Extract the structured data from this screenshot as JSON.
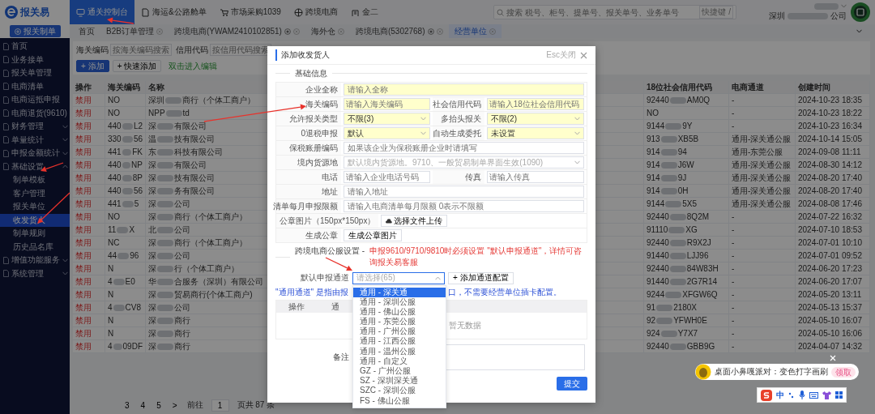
{
  "topbar": {
    "app_name": "报关易",
    "nav": [
      {
        "label": "通关控制台",
        "selected": true
      },
      {
        "label": "海运&公路舱单",
        "selected": false
      },
      {
        "label": "市场采购1039",
        "selected": false
      },
      {
        "label": "跨境电商",
        "selected": false
      },
      {
        "label": "金二",
        "selected": false
      }
    ],
    "search": {
      "placeholder": "搜索 税号、柜号、提单号、报关单号、业务单号",
      "shortcut": "快捷键 /"
    },
    "company": [
      "深圳",
      "公司"
    ]
  },
  "create_button": "报关制单",
  "page_tabs": [
    {
      "label": "首页",
      "selected": false,
      "closable": false,
      "pinned": false
    },
    {
      "label": "B2B订单管理",
      "selected": false,
      "closable": true,
      "pinned": false
    },
    {
      "label": "跨境电商(YWAM2410102851)",
      "selected": false,
      "closable": true,
      "pinned": true
    },
    {
      "label": "海外仓",
      "selected": false,
      "closable": true,
      "pinned": false
    },
    {
      "label": "跨境电商(5302768)",
      "selected": false,
      "closable": true,
      "pinned": true
    },
    {
      "label": "经营单位",
      "selected": true,
      "closable": true,
      "pinned": false
    }
  ],
  "sidebar": [
    {
      "label": "首页",
      "selected": false
    },
    {
      "label": "业务接单",
      "selected": false
    },
    {
      "label": "报关单管理",
      "selected": false
    },
    {
      "label": "电商清单",
      "selected": false
    },
    {
      "label": "电商运抵申报",
      "selected": false
    },
    {
      "label": "电商退货(9610)",
      "selected": false
    },
    {
      "label": "财务管理",
      "selected": false,
      "expanded": false
    },
    {
      "label": "单量统计",
      "selected": false,
      "expanded": false
    },
    {
      "label": "申报金额统计",
      "selected": false,
      "expanded": false
    },
    {
      "label": "基础设置",
      "selected": false,
      "expanded": true,
      "children": [
        {
          "label": "制单模板",
          "selected": false
        },
        {
          "label": "客户管理",
          "selected": false
        },
        {
          "label": "报关单位",
          "selected": false
        },
        {
          "label": "收发货人",
          "selected": true
        },
        {
          "label": "制单规则",
          "selected": false
        },
        {
          "label": "历史品名库",
          "selected": false
        }
      ]
    },
    {
      "label": "增值功能服务",
      "selected": false,
      "expanded": false
    },
    {
      "label": "系统管理",
      "selected": false,
      "expanded": false
    }
  ],
  "filters": [
    {
      "label": "海关编码",
      "placeholder": "按海关编码搜索"
    },
    {
      "label": "信用代码",
      "placeholder": "按信用代码搜索"
    }
  ],
  "actions": [
    {
      "label": "+ 添加",
      "kind": "primary"
    },
    {
      "label": "+ 快速添加",
      "kind": "plain"
    },
    {
      "label": "双击进入编辑",
      "kind": "hint"
    }
  ],
  "table": {
    "columns": [
      "操作",
      "海关编码",
      "名称",
      "18位社会信用代码",
      "电商通道",
      "创建时间"
    ],
    "rows": [
      {
        "action": "禁用",
        "code": "NO",
        "name": [
          "深圳",
          "商行（个体工商户）"
        ],
        "credit": [
          "92440",
          "AM0Q"
        ],
        "channel": "-",
        "created": "2024-10-23 18:35"
      },
      {
        "action": "禁用",
        "code": "NO",
        "name": [
          "NPP",
          "td"
        ],
        "credit": "NO",
        "channel": "-",
        "created": "2024-10-23 18:22"
      },
      {
        "action": "禁用",
        "code": [
          "440",
          "L2"
        ],
        "name": [
          "深",
          "有限公司"
        ],
        "credit": [
          "9144",
          "9Y"
        ],
        "channel": "-",
        "created": "2024-10-23 16:34"
      },
      {
        "action": "禁用",
        "code": [
          "330",
          "56"
        ],
        "name": [
          "温",
          "技有限公司"
        ],
        "credit": [
          "913",
          "XB5B"
        ],
        "channel": "通用-深关通公服",
        "created": "2024-10-14 15:05"
      },
      {
        "action": "禁用",
        "code": [
          "441",
          "FK"
        ],
        "name": [
          "东",
          "科技有限公司"
        ],
        "credit": [
          "914",
          "94"
        ],
        "channel": "通用-东莞公服",
        "created": "2024-09-08 11:11"
      },
      {
        "action": "禁用",
        "code": [
          "440",
          "NP"
        ],
        "name": [
          "深",
          "有限公司"
        ],
        "credit": [
          "914",
          "J6W"
        ],
        "channel": "通用-深关通公服",
        "created": "2024-08-30 14:12"
      },
      {
        "action": "禁用",
        "code": [
          "440",
          "8P"
        ],
        "name": [
          "深",
          "技有限公司"
        ],
        "credit": [
          "914",
          "9J"
        ],
        "channel": "通用-深关通公服",
        "created": "2024-08-20 17:40"
      },
      {
        "action": "禁用",
        "code": [
          "440",
          "56"
        ],
        "name": [
          "深",
          "务有限公司"
        ],
        "credit": [
          "914",
          "0H"
        ],
        "channel": "通用-深关通公服",
        "created": "2024-08-20 17:40"
      },
      {
        "action": "禁用",
        "code": [
          "441",
          "5"
        ],
        "name": [
          "深",
          "公司"
        ],
        "credit": [
          "9144",
          "5X5"
        ],
        "channel": "通用-深关通公服",
        "created": "2024-08-08 17:46"
      },
      {
        "action": "禁用",
        "code": "NO",
        "name": [
          "深",
          "商行（个体工商户）"
        ],
        "credit": [
          "92440",
          "8Q2M"
        ],
        "channel": "-",
        "created": "2024-07-22 16:32"
      },
      {
        "action": "禁用",
        "code": [
          "11",
          "X"
        ],
        "name": [
          "北",
          "公司"
        ],
        "credit": [
          "91110",
          "XG"
        ],
        "channel": "-",
        "created": "2024-07-10 18:53"
      },
      {
        "action": "禁用",
        "code": "NC",
        "name": [
          "深",
          "商行（个体工商户）"
        ],
        "credit": [
          "92440",
          "R9X2J"
        ],
        "channel": "-",
        "created": "2024-07-01 10:10"
      },
      {
        "action": "禁用",
        "code": [
          "44",
          "96"
        ],
        "name": [
          "深",
          "公司"
        ],
        "credit": [
          "91440",
          "LJJ96"
        ],
        "channel": "-",
        "created": "2024-07-01 09:52"
      },
      {
        "action": "禁用",
        "code": "N",
        "name": [
          "深",
          "行（个体工商户）"
        ],
        "credit": [
          "92440",
          "84W83H"
        ],
        "channel": "-",
        "created": "2024-06-20 17:23"
      },
      {
        "action": "禁用",
        "code": [
          "4",
          "E0"
        ],
        "name": [
          "华",
          "合服务（深圳）有限公司"
        ],
        "credit": [
          "91440",
          "2G7R14"
        ],
        "channel": "-",
        "created": "2024-06-20 17:07"
      },
      {
        "action": "禁用",
        "code": "N",
        "name": [
          "深",
          "贸易商行(个体工商户)"
        ],
        "credit": [
          "9244",
          "XFGW6Q"
        ],
        "channel": "-",
        "created": "2024-05-20 13:11"
      },
      {
        "action": "禁用",
        "code": [
          "4",
          "CV8"
        ],
        "name": [
          "深",
          "公司"
        ],
        "credit": [
          "91",
          "2180X"
        ],
        "channel": "-",
        "created": "2024-05-13 15:37"
      },
      {
        "action": "禁用",
        "code": "N",
        "name": [
          "深",
          "商行"
        ],
        "credit": [
          "92",
          "YFWH0E"
        ],
        "channel": "-",
        "created": "2024-05-10 16:07"
      },
      {
        "action": "禁用",
        "code": "N",
        "name": [
          "深",
          "商行"
        ],
        "credit": [
          "924",
          "Y7X7"
        ],
        "channel": "-",
        "created": "2024-05-10 16:06"
      },
      {
        "action": "禁用",
        "code": [
          "4",
          "09DF"
        ],
        "name": [
          "深",
          "商行"
        ],
        "credit": [
          "92440",
          "GBB9G"
        ],
        "channel": "-",
        "created": "2024-04-07 14:32"
      }
    ]
  },
  "pager": {
    "pages": [
      "3",
      "4",
      "5"
    ],
    "next": ">",
    "goto_label": "前往",
    "goto_value": "1",
    "total": "页共 87 条"
  },
  "modal": {
    "title": "添加收发货人",
    "esc_hint": "Esc关闭",
    "basic_section": "基础信息",
    "rows": [
      [
        {
          "label": "企业全称",
          "kind": "input",
          "placeholder": "请输入全称",
          "required": true
        }
      ],
      [
        {
          "label": "海关编码",
          "kind": "input",
          "placeholder": "请输入海关编码",
          "required": true
        },
        {
          "label": "社会信用代码",
          "kind": "input",
          "placeholder": "请输入18位社会信用代码",
          "required": true
        }
      ],
      [
        {
          "label": "允许报关类型",
          "kind": "select",
          "value": "不限(3)",
          "required": true
        },
        {
          "label": "多抬头报关",
          "kind": "select",
          "value": "不限(2)",
          "required": true
        }
      ],
      [
        {
          "label": "0退税申报",
          "kind": "select",
          "value": "默认",
          "required": true
        },
        {
          "label": "自动生成委托",
          "kind": "select",
          "value": "未设置",
          "required": true
        }
      ],
      [
        {
          "label": "保税账册编码",
          "kind": "input",
          "placeholder": "如果该企业为保税账册企业时请填写",
          "required": false
        }
      ],
      [
        {
          "label": "境内货源地",
          "kind": "select",
          "placeholder": "默认境内货源地。9710、一般贸易制单界面生效(1090)",
          "required": false
        }
      ],
      [
        {
          "label": "电话",
          "kind": "input",
          "placeholder": "请输入企业电话号码",
          "required": false
        },
        {
          "label": "传真",
          "kind": "input",
          "placeholder": "请输入传真",
          "required": false
        }
      ],
      [
        {
          "label": "地址",
          "kind": "input",
          "placeholder": "请输入地址",
          "required": false
        }
      ],
      [
        {
          "label": "清单每月申报限额",
          "kind": "input",
          "placeholder": "请输入电商清单每月限额 0表示不限额",
          "required": false
        }
      ],
      [
        {
          "label": "公章图片（150px*150px）",
          "kind": "upload",
          "button": "选择文件上传"
        }
      ],
      [
        {
          "label": "生成公章",
          "kind": "button",
          "button": "生成公章图片"
        }
      ]
    ],
    "ecom_section": {
      "title": "跨境电商公服设置 -",
      "warning": "申报9610/9710/9810时必须设置 \"默认申报通道\"，详情可咨询报关易客服"
    },
    "channel": {
      "label": "默认申报通道",
      "placeholder": "请选择(65)",
      "expanded": true,
      "add_button": "+ 添加通道配置",
      "options": [
        {
          "label": "通用 - 深关通",
          "selected": true
        },
        {
          "label": "通用 - 深圳公服",
          "selected": false
        },
        {
          "label": "通用 - 佛山公服",
          "selected": false
        },
        {
          "label": "通用 - 东莞公服",
          "selected": false
        },
        {
          "label": "通用 - 广州公服",
          "selected": false
        },
        {
          "label": "通用 - 江西公服",
          "selected": false
        },
        {
          "label": "通用 - 温州公服",
          "selected": false
        },
        {
          "label": "通用 - 自定义",
          "selected": false
        },
        {
          "label": "GZ - 广州公服",
          "selected": false
        },
        {
          "label": "SZ - 深圳深关通",
          "selected": false
        },
        {
          "label": "SZC - 深圳公服",
          "selected": false
        },
        {
          "label": "FS - 佛山公服",
          "selected": false
        }
      ]
    },
    "note": [
      "\"通用通道\" 是指由报",
      "口，不需要经营单位插卡配置。"
    ],
    "channel_table": {
      "columns": [
        "操作",
        "通"
      ],
      "empty": "暂无数据"
    },
    "remark_label": "备注",
    "submit": "提交"
  },
  "notification": {
    "text": "桌面小鼻嘎派对：变色打字画刷",
    "badge": "领取"
  },
  "ime": {
    "mode": "中"
  }
}
